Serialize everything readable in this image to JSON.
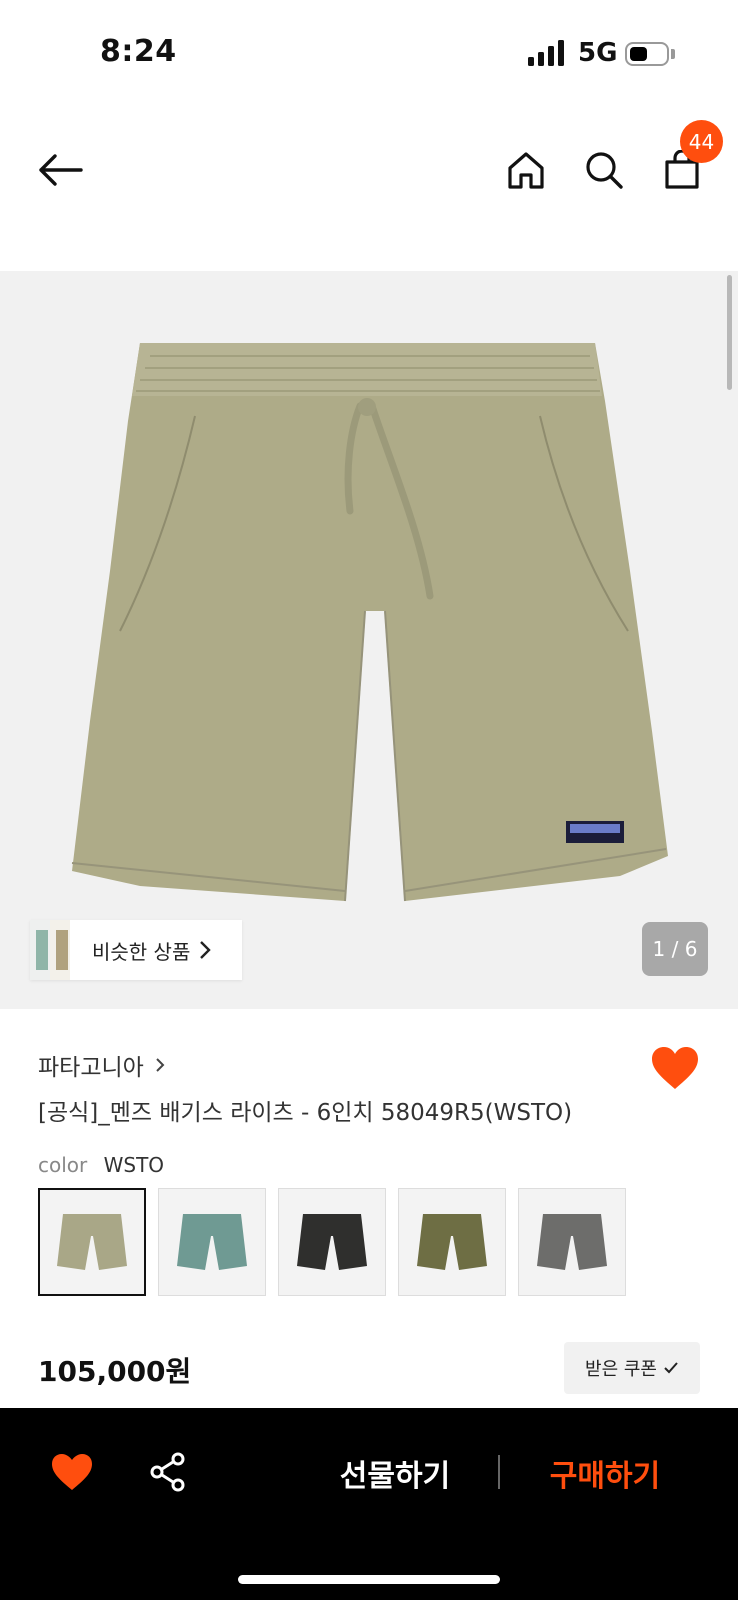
{
  "status_bar": {
    "time": "8:24",
    "network": "5G"
  },
  "header": {
    "cart_count": "44"
  },
  "colors": {
    "accent": "#ff4e0e",
    "bottom_bar": "#000000"
  },
  "gallery": {
    "similar_label": "비슷한 상품",
    "counter": "1 / 6"
  },
  "product": {
    "brand": "파타고니아",
    "title": "[공식]_멘즈 배기스 라이츠 - 6인치 58049R5(WSTO)",
    "color_label": "color",
    "color_value": "WSTO",
    "swatches": [
      {
        "color": "#a9a787",
        "name": "WSTO",
        "selected": true
      },
      {
        "color": "#6f9a93",
        "name": "teal"
      },
      {
        "color": "#2f2f2d",
        "name": "black"
      },
      {
        "color": "#6e6e44",
        "name": "olive"
      },
      {
        "color": "#6d6d6b",
        "name": "grey"
      }
    ],
    "price": "105,000원",
    "coupon_label": "받은 쿠폰"
  },
  "bottom_bar": {
    "gift_label": "선물하기",
    "buy_label": "구매하기"
  }
}
